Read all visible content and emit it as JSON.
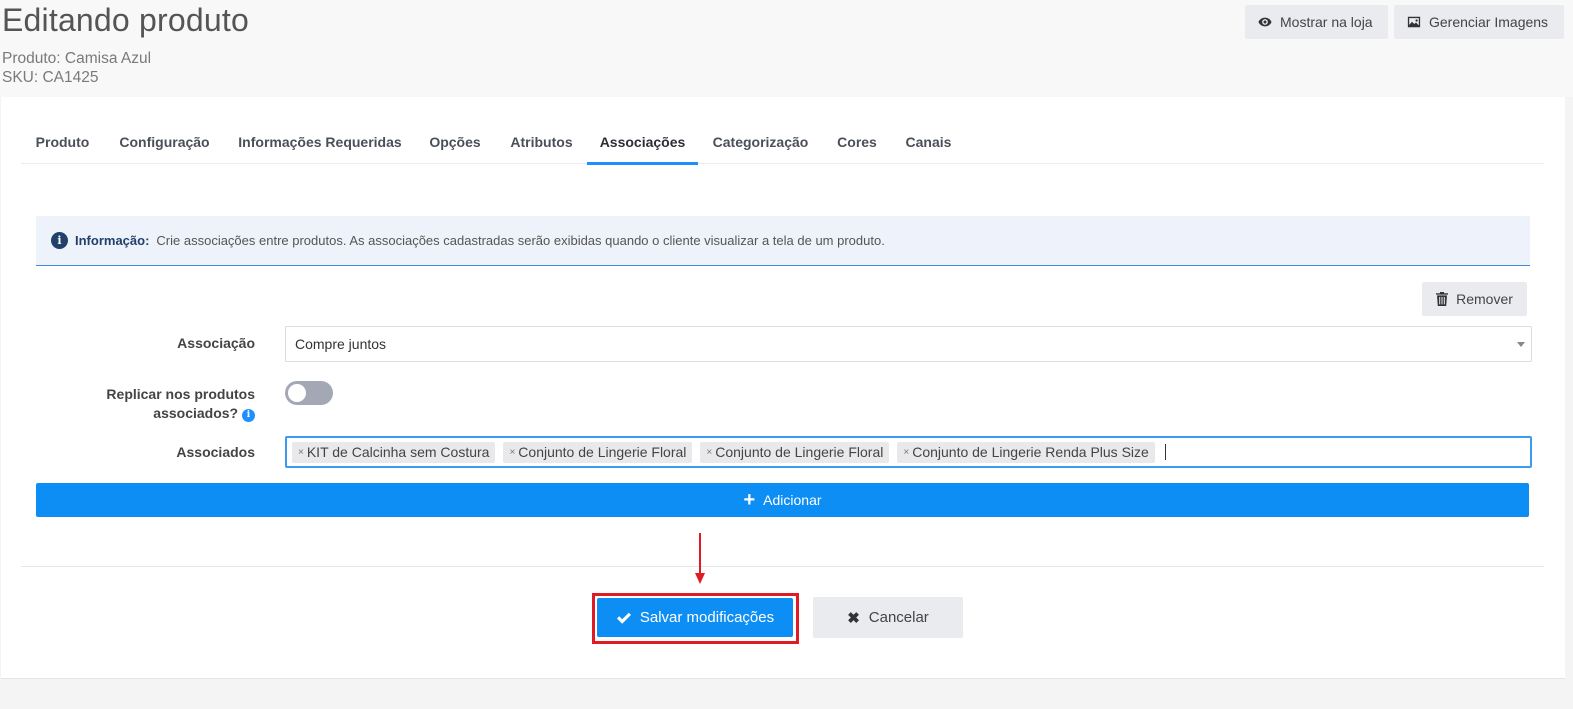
{
  "header": {
    "title": "Editando produto",
    "product_line": "Produto: Camisa Azul",
    "sku_line": "SKU: CA1425",
    "show_in_store_label": "Mostrar na loja",
    "manage_images_label": "Gerenciar Imagens"
  },
  "tabs": [
    {
      "label": "Produto"
    },
    {
      "label": "Configuração"
    },
    {
      "label": "Informações Requeridas"
    },
    {
      "label": "Opções"
    },
    {
      "label": "Atributos"
    },
    {
      "label": "Associações"
    },
    {
      "label": "Categorização"
    },
    {
      "label": "Cores"
    },
    {
      "label": "Canais"
    }
  ],
  "active_tab": "Associações",
  "info": {
    "label": "Informação:",
    "text": "Crie associações entre produtos. As associações cadastradas serão exibidas quando o cliente visualizar a tela de um produto."
  },
  "remove_label": "Remover",
  "form": {
    "association_label": "Associação",
    "association_value": "Compre juntos",
    "replicate_label_line1": "Replicar nos produtos",
    "replicate_label_line2": "associados?",
    "replicate_enabled": false,
    "associated_label": "Associados",
    "associated_tags": [
      "KIT de Calcinha sem Costura",
      "Conjunto de Lingerie Floral",
      "Conjunto de Lingerie Floral",
      "Conjunto de Lingerie Renda Plus Size"
    ]
  },
  "add_label": "Adicionar",
  "save_label": "Salvar modificações",
  "cancel_label": "Cancelar",
  "colors": {
    "primary": "#0d8ef5",
    "highlight": "#e01b24",
    "info_dark": "#21406b"
  }
}
